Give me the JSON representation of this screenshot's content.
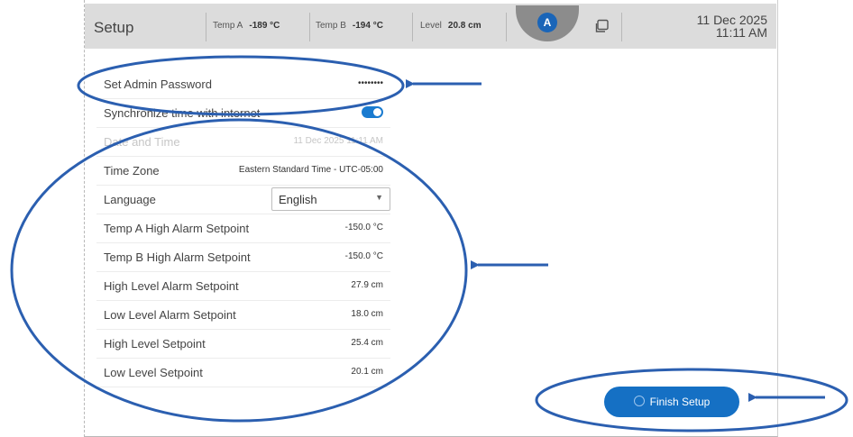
{
  "header": {
    "title": "Setup",
    "temp_a_label": "Temp A",
    "temp_a_value": "-189 °C",
    "temp_b_label": "Temp B",
    "temp_b_value": "-194 °C",
    "level_label": "Level",
    "level_value": "20.8 cm",
    "badge": "A",
    "date": "11 Dec 2025",
    "time": "11:11 AM"
  },
  "settings": [
    {
      "label": "Set Admin Password",
      "value": "••••••••",
      "kind": "password"
    },
    {
      "label": "Synchronize time with internet",
      "kind": "toggle",
      "on": true
    },
    {
      "label": "Date and Time",
      "value": "11 Dec 2025 11:11 AM",
      "kind": "disabled"
    },
    {
      "label": "Time Zone",
      "value": "Eastern Standard Time - UTC-05:00"
    },
    {
      "label": "Language",
      "value": "English",
      "kind": "select"
    },
    {
      "label": "Temp A High Alarm Setpoint",
      "value": "-150.0 °C"
    },
    {
      "label": "Temp B High Alarm Setpoint",
      "value": "-150.0 °C"
    },
    {
      "label": "High Level Alarm Setpoint",
      "value": "27.9 cm"
    },
    {
      "label": "Low Level Alarm Setpoint",
      "value": "18.0 cm"
    },
    {
      "label": "High Level Setpoint",
      "value": "25.4 cm"
    },
    {
      "label": "Low Level Setpoint",
      "value": "20.1 cm"
    }
  ],
  "finish_label": "Finish Setup",
  "annotation_color": "#2b5fb0",
  "icons": [
    "device-icon",
    "check-circle-icon",
    "chevron-down-icon"
  ]
}
